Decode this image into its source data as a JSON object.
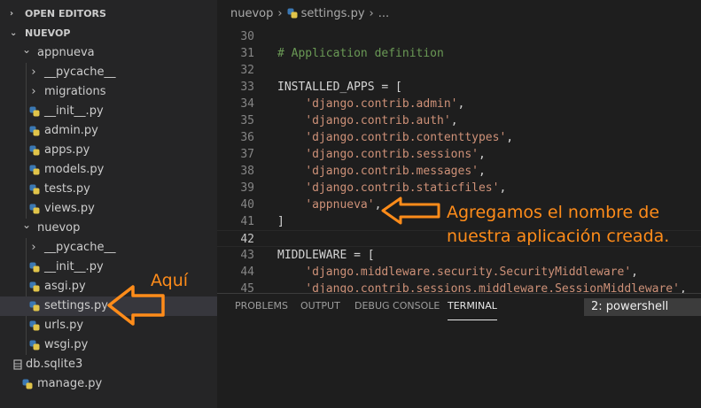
{
  "sidebar": {
    "open_editors": "OPEN EDITORS",
    "workspace": "NUEVOP",
    "items": [
      {
        "label": "appnueva",
        "type": "folder"
      },
      {
        "label": "__pycache__",
        "type": "folder"
      },
      {
        "label": "migrations",
        "type": "folder"
      },
      {
        "label": "__init__.py",
        "type": "python"
      },
      {
        "label": "admin.py",
        "type": "python"
      },
      {
        "label": "apps.py",
        "type": "python"
      },
      {
        "label": "models.py",
        "type": "python"
      },
      {
        "label": "tests.py",
        "type": "python"
      },
      {
        "label": "views.py",
        "type": "python"
      },
      {
        "label": "nuevop",
        "type": "folder"
      },
      {
        "label": "__pycache__",
        "type": "folder"
      },
      {
        "label": "__init__.py",
        "type": "python"
      },
      {
        "label": "asgi.py",
        "type": "python"
      },
      {
        "label": "settings.py",
        "type": "python"
      },
      {
        "label": "urls.py",
        "type": "python"
      },
      {
        "label": "wsgi.py",
        "type": "python"
      },
      {
        "label": "db.sqlite3",
        "type": "database"
      },
      {
        "label": "manage.py",
        "type": "python"
      }
    ]
  },
  "breadcrumb": {
    "folder": "nuevop",
    "file": "settings.py",
    "more": "..."
  },
  "editor": {
    "lines": [
      {
        "n": "30",
        "text": ""
      },
      {
        "n": "31",
        "text": "# Application definition"
      },
      {
        "n": "32",
        "text": ""
      },
      {
        "n": "33",
        "text": "INSTALLED_APPS = ["
      },
      {
        "n": "34",
        "text": "    'django.contrib.admin',"
      },
      {
        "n": "35",
        "text": "    'django.contrib.auth',"
      },
      {
        "n": "36",
        "text": "    'django.contrib.contenttypes',"
      },
      {
        "n": "37",
        "text": "    'django.contrib.sessions',"
      },
      {
        "n": "38",
        "text": "    'django.contrib.messages',"
      },
      {
        "n": "39",
        "text": "    'django.contrib.staticfiles',"
      },
      {
        "n": "40",
        "text": "    'appnueva',"
      },
      {
        "n": "41",
        "text": "]"
      },
      {
        "n": "42",
        "text": ""
      },
      {
        "n": "43",
        "text": "MIDDLEWARE = ["
      },
      {
        "n": "44",
        "text": "    'django.middleware.security.SecurityMiddleware',"
      },
      {
        "n": "45",
        "text": "    'django.contrib.sessions.middleware.SessionMiddleware',"
      }
    ]
  },
  "panel": {
    "tabs": [
      "PROBLEMS",
      "OUTPUT",
      "DEBUG CONSOLE",
      "TERMINAL"
    ],
    "active_tab": "TERMINAL",
    "terminal_select": "2: powershell"
  },
  "annotations": {
    "editor_note_line1": "Agregamos el nombre de",
    "editor_note_line2": "nuestra aplicación creada.",
    "sidebar_note": "Aquí",
    "color": "#ff8c1a"
  },
  "colors": {
    "comment": "#6a9955",
    "string": "#ce9178",
    "python_icon_blue": "#3b78b3",
    "python_icon_yellow": "#e0c44a"
  }
}
